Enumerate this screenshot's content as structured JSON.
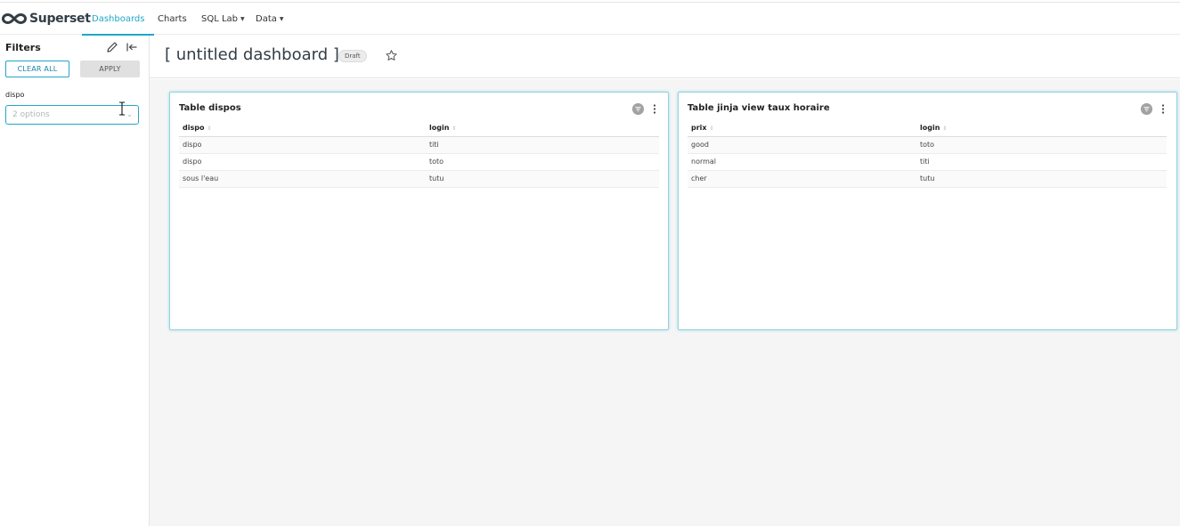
{
  "brand": {
    "name": "Superset"
  },
  "nav": {
    "items": [
      {
        "label": "Dashboards",
        "active": true
      },
      {
        "label": "Charts",
        "active": false
      },
      {
        "label": "SQL Lab",
        "active": false
      },
      {
        "label": "Data",
        "active": false
      }
    ]
  },
  "sidebar": {
    "title": "Filters",
    "clear_all_label": "CLEAR ALL",
    "apply_label": "APPLY",
    "filter": {
      "label": "dispo",
      "placeholder": "2 options"
    }
  },
  "dashboard": {
    "title": "[ untitled dashboard ]",
    "status": "Draft"
  },
  "charts": [
    {
      "title": "Table dispos",
      "columns": [
        "dispo",
        "login"
      ],
      "rows": [
        [
          "dispo",
          "titi"
        ],
        [
          "dispo",
          "toto"
        ],
        [
          "sous l'eau",
          "tutu"
        ]
      ]
    },
    {
      "title": "Table jinja view taux horaire",
      "columns": [
        "prix",
        "login"
      ],
      "rows": [
        [
          "good",
          "toto"
        ],
        [
          "normal",
          "titi"
        ],
        [
          "cher",
          "tutu"
        ]
      ]
    }
  ],
  "colors": {
    "accent": "#20a7c9",
    "background": "#f5f5f5"
  },
  "icons": {
    "logo": "superset-infinity-logo",
    "edit": "pencil-icon",
    "collapse": "collapse-left-icon",
    "favorite": "star-icon",
    "chart_filter": "filter-icon",
    "chart_menu": "more-vertical-icon"
  }
}
